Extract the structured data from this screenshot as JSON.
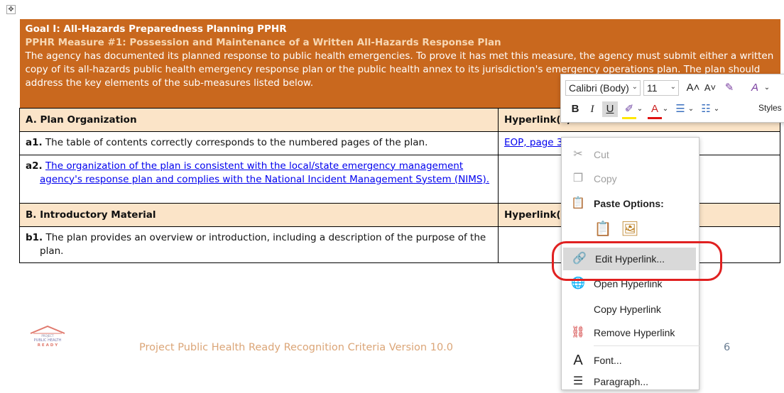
{
  "document": {
    "header": {
      "title": "Goal I: All-Hazards Preparedness Planning PPHR",
      "subtitle": "PPHR Measure #1: Possession and Maintenance of a Written All-Hazards Response Plan",
      "body": "The agency has documented its planned response to public health emergencies. To prove it has met this measure, the agency must submit either a written copy of its all-hazards public health emergency response plan or the public health annex to its jurisdiction's emergency operations plan. The plan should address the key elements of the sub-measures listed below."
    },
    "section_a": {
      "label": "A.  Plan Organization",
      "column": "Hyperlink(s)"
    },
    "a1": {
      "code": "a1.",
      "text": " The table of contents correctly corresponds to the numbered pages of the plan.",
      "link": "EOP, page 3"
    },
    "a2": {
      "code": "a2.",
      "link_text": "The organization of the plan is consistent with the local/state emergency management agency's response plan and complies with the National Incident Management System (NIMS)."
    },
    "section_b": {
      "label": "B.  Introductory Material",
      "column": "Hyperlink(s)"
    },
    "b1": {
      "code": "b1.",
      "text": " The plan provides an overview or introduction, including a description of the purpose of the plan."
    }
  },
  "footer": {
    "logo_line1": "PROJECT",
    "logo_line2": "PUBLIC HEALTH",
    "logo_line3": "R E A D Y",
    "text": "Project Public Health Ready Recognition Criteria Version 10.0",
    "page_number": "6"
  },
  "mini_toolbar": {
    "font": "Calibri (Body)",
    "size": "11",
    "grow_font": "A˄",
    "shrink_font": "A˅",
    "bold": "B",
    "italic": "I",
    "underline": "U",
    "styles_label": "Styles"
  },
  "context_menu": {
    "cut": "Cut",
    "copy": "Copy",
    "paste_options": "Paste Options:",
    "edit_hyperlink": "Edit Hyperlink...",
    "open_hyperlink": "Open Hyperlink",
    "copy_hyperlink": "Copy Hyperlink",
    "remove_hyperlink": "Remove Hyperlink",
    "font": "Font...",
    "paragraph": "Paragraph..."
  },
  "colors": {
    "header_bg": "#c9681e",
    "section_bg": "#fbe4c8",
    "link": "#0000ee",
    "highlight_oval": "#e02020"
  }
}
